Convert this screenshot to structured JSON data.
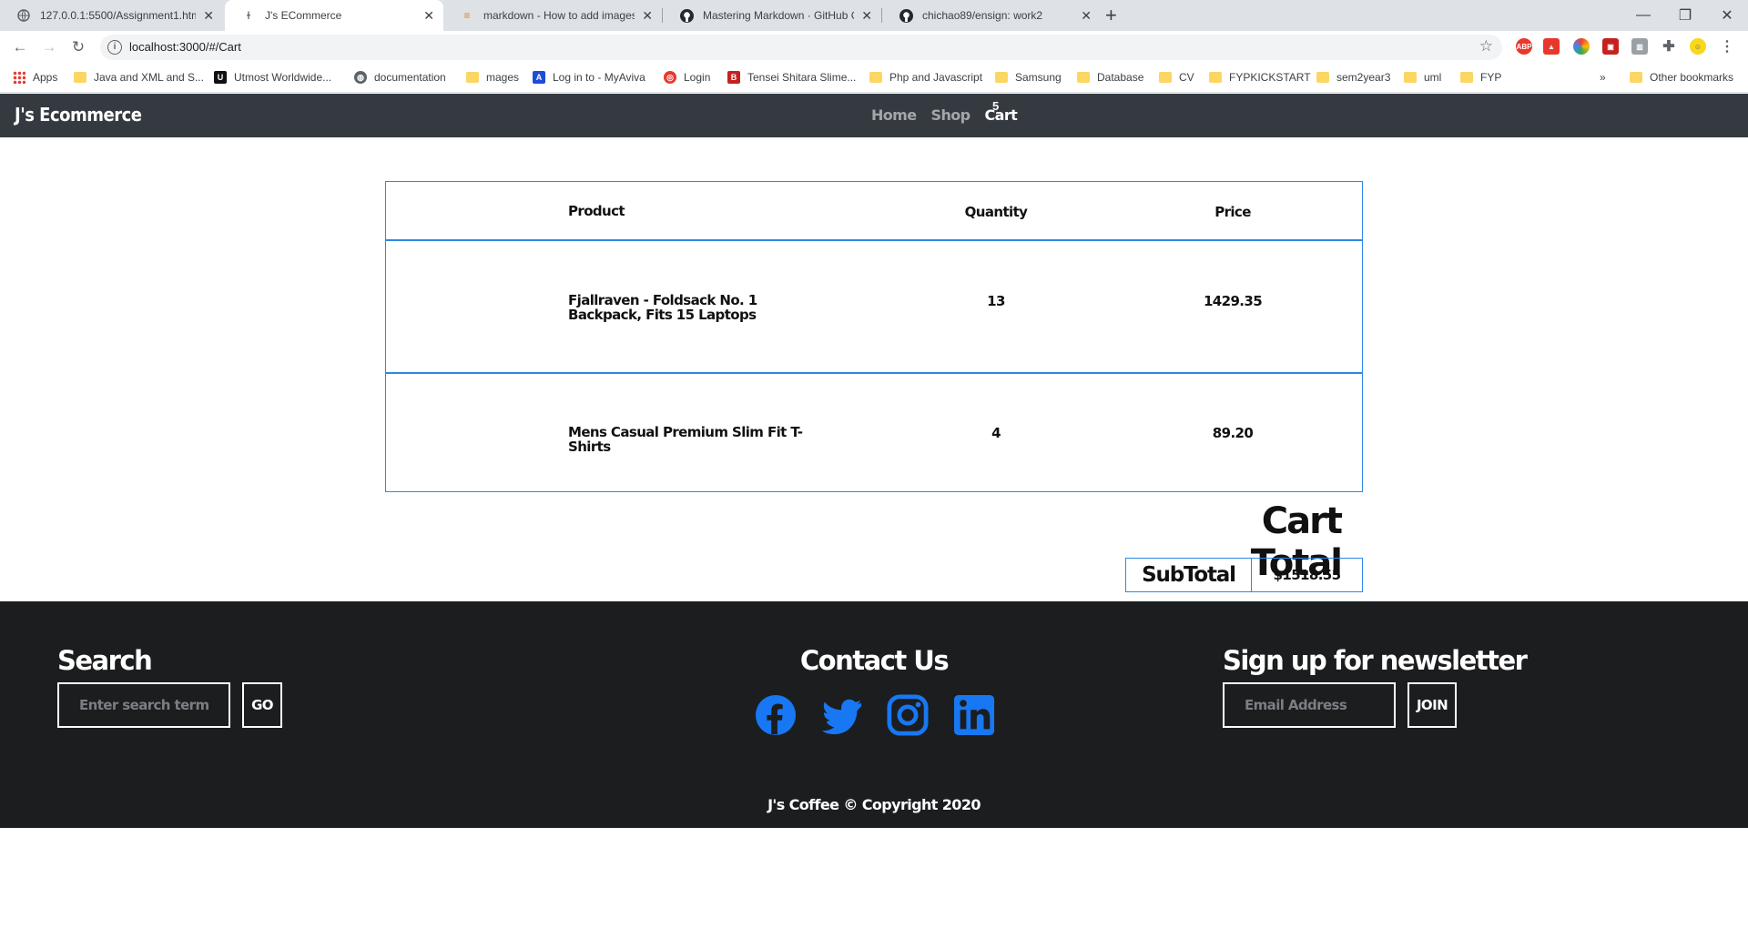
{
  "browser": {
    "tabs": [
      {
        "title": "127.0.0.1:5500/Assignment1.html",
        "icon": "globe-icon"
      },
      {
        "title": "J's ECommerce",
        "icon": "page-icon"
      },
      {
        "title": "markdown - How to add images",
        "icon": "stackoverflow-icon"
      },
      {
        "title": "Mastering Markdown · GitHub G",
        "icon": "github-icon"
      },
      {
        "title": "chichao89/ensign: work2",
        "icon": "github-icon"
      }
    ],
    "url": "localhost:3000/#/Cart",
    "bookmarks": [
      {
        "label": "Apps",
        "icon": "apps-grid-icon"
      },
      {
        "label": "Java and XML and S...",
        "icon": "folder-icon"
      },
      {
        "label": "Utmost Worldwide...",
        "icon": "udemy-icon"
      },
      {
        "label": "documentation",
        "icon": "globe-icon"
      },
      {
        "label": "mages",
        "icon": "folder-icon"
      },
      {
        "label": "Log in to - MyAviva",
        "icon": "aviva-icon"
      },
      {
        "label": "Login",
        "icon": "login-icon"
      },
      {
        "label": "Tensei Shitara Slime...",
        "icon": "b-icon"
      },
      {
        "label": "Php and Javascript",
        "icon": "folder-icon"
      },
      {
        "label": "Samsung",
        "icon": "folder-icon"
      },
      {
        "label": "Database",
        "icon": "folder-icon"
      },
      {
        "label": "CV",
        "icon": "folder-icon"
      },
      {
        "label": "FYPKICKSTART",
        "icon": "folder-icon"
      },
      {
        "label": "sem2year3",
        "icon": "folder-icon"
      },
      {
        "label": "uml",
        "icon": "folder-icon"
      },
      {
        "label": "FYP",
        "icon": "folder-icon"
      }
    ],
    "more_bookmarks": "»",
    "other_bookmarks": "Other bookmarks"
  },
  "site": {
    "brand": "J's Ecommerce",
    "nav": [
      {
        "label": "Home"
      },
      {
        "label": "Shop"
      },
      {
        "label": "Cart"
      }
    ],
    "cart_count": "5"
  },
  "cart": {
    "headers": {
      "product": "Product",
      "quantity": "Quantity",
      "price": "Price"
    },
    "items": [
      {
        "product": "Fjallraven - Foldsack No. 1 Backpack, Fits 15 Laptops",
        "quantity": "13",
        "price": "1429.35"
      },
      {
        "product": "Mens Casual Premium Slim Fit T-Shirts",
        "quantity": "4",
        "price": "89.20"
      }
    ],
    "total_title": "Cart Total",
    "subtotal_label": "SubTotal",
    "subtotal_value": "$1518.55"
  },
  "footer": {
    "search_title": "Search",
    "search_placeholder": "Enter search term",
    "search_button": "GO",
    "contact_title": "Contact Us",
    "social": [
      "facebook-icon",
      "twitter-icon",
      "instagram-icon",
      "linkedin-icon"
    ],
    "newsletter_title": "Sign up for newsletter",
    "email_placeholder": "Email Address",
    "join_button": "JOIN",
    "copyright": "J's Coffee © Copyright 2020"
  },
  "colors": {
    "accent_blue": "#2d89e5",
    "nav_bg": "#343a40",
    "footer_bg": "#1b1d1f",
    "social_blue": "#1877f2"
  }
}
